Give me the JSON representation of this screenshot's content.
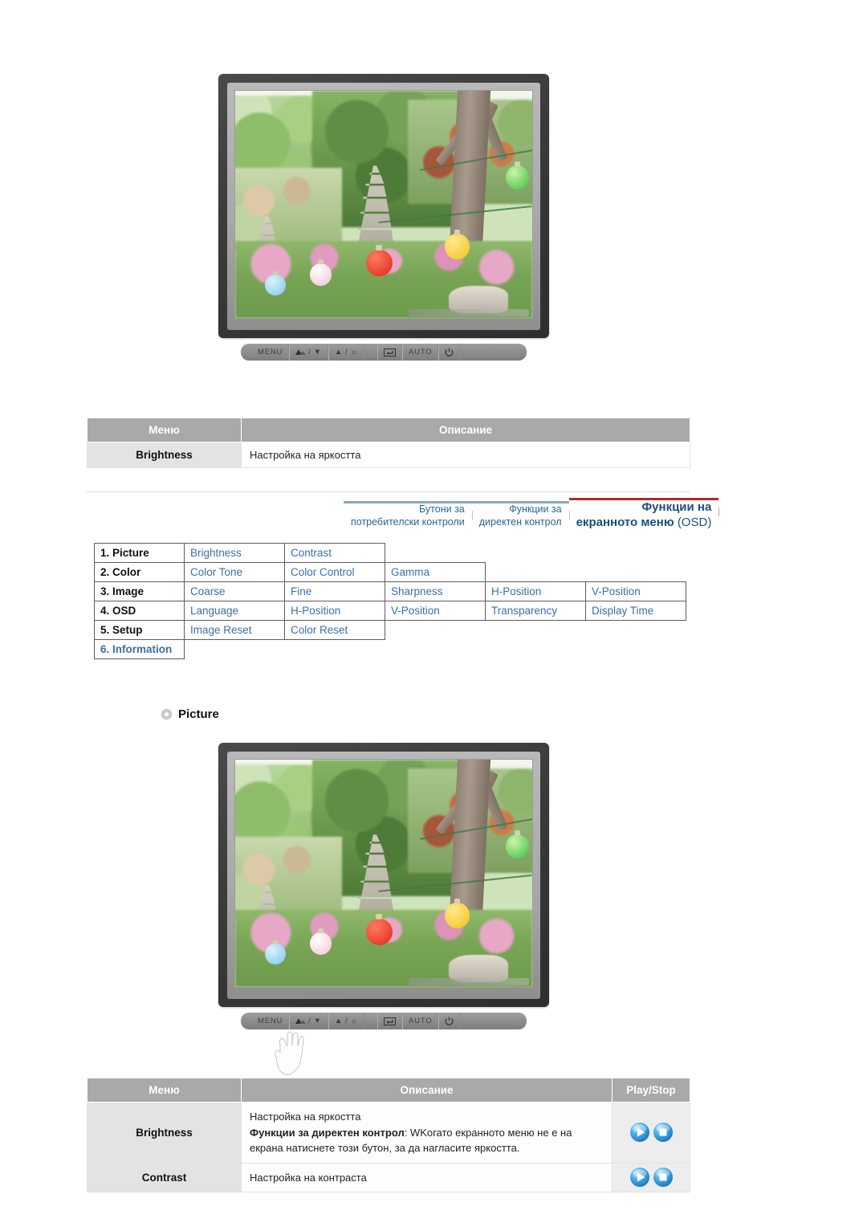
{
  "page": {
    "title": "Samsung Monitor OSD — Picture",
    "language": "bg"
  },
  "nav": {
    "tabs": [
      {
        "line1": "Бутони за",
        "line2": "потребителски контроли",
        "active": false
      },
      {
        "line1": "Функции за",
        "line2": "директен контрол",
        "active": false
      },
      {
        "line1": "Функции на",
        "line2": "екранното меню ",
        "line2_light": "(OSD)",
        "active": true
      }
    ],
    "active_color": "#b02a2a",
    "inactive_color": "#8ba7bd"
  },
  "monitor_top": {
    "buttons": [
      {
        "label": "MENU",
        "icon": "menu-button"
      },
      {
        "label": "/ ▼",
        "icon": "contrast-down-button"
      },
      {
        "label": "▲ /",
        "icon": "brightness-up-button"
      },
      {
        "label": "",
        "icon": "enter-source-button"
      },
      {
        "label": "AUTO",
        "icon": "auto-button"
      },
      {
        "label": "",
        "icon": "power-button"
      }
    ],
    "screen_scene": "garden with stone pagoda, trees and colored paper lanterns"
  },
  "monitor_bottom": {
    "buttons": [
      {
        "label": "MENU",
        "icon": "menu-button"
      },
      {
        "label": "/ ▼",
        "icon": "contrast-down-button"
      },
      {
        "label": "▲ /",
        "icon": "brightness-up-button"
      },
      {
        "label": "",
        "icon": "enter-source-button"
      },
      {
        "label": "AUTO",
        "icon": "auto-button"
      },
      {
        "label": "",
        "icon": "power-button"
      }
    ],
    "pointer": "hand-cursor pointing at MENU button",
    "screen_scene": "garden with stone pagoda, trees and colored paper lanterns"
  },
  "table_top": {
    "headers": [
      "Меню",
      "Описание"
    ],
    "rows": [
      {
        "menu": "Brightness",
        "desc": "Настройка на яркостта"
      }
    ]
  },
  "osd_structure": {
    "rows": [
      {
        "category": "1. Picture",
        "category_blue": false,
        "items": [
          "Brightness",
          "Contrast"
        ]
      },
      {
        "category": "2. Color",
        "category_blue": false,
        "items": [
          "Color Tone",
          "Color Control",
          "Gamma"
        ]
      },
      {
        "category": "3. Image",
        "category_blue": false,
        "items": [
          "Coarse",
          "Fine",
          "Sharpness",
          "H-Position",
          "V-Position"
        ]
      },
      {
        "category": "4. OSD",
        "category_blue": false,
        "items": [
          "Language",
          "H-Position",
          "V-Position",
          "Transparency",
          "Display Time"
        ]
      },
      {
        "category": "5. Setup",
        "category_blue": false,
        "items": [
          "Image Reset",
          "Color Reset"
        ]
      },
      {
        "category": "6. Information",
        "category_blue": true,
        "items": []
      }
    ],
    "item_color": "#3c6fa8"
  },
  "section": {
    "heading": "Picture",
    "icon": "diamond-bullet-icon"
  },
  "table_bottom": {
    "headers": [
      "Меню",
      "Описание",
      "Play/Stop"
    ],
    "rows": [
      {
        "menu": "Brightness",
        "desc_line1": "Настройка на яркостта",
        "desc_bold": "Функции за директен контрол",
        "desc_rest": ": WKогато екранното меню не е на екрана натиснете този бутон, за да нагласите яркостта.",
        "play_icon": "play-icon",
        "stop_icon": "stop-icon"
      },
      {
        "menu": "Contrast",
        "desc_line1": "Настройка на контраста",
        "desc_bold": "",
        "desc_rest": "",
        "play_icon": "play-icon",
        "stop_icon": "stop-icon"
      }
    ]
  },
  "colors": {
    "table_header_bg": "#a9a9a9",
    "menu_cell_bg": "#e3e3e3",
    "link_blue": "#3c6fa8",
    "accent_red": "#b02a2a",
    "play_blue": "#3aa0e0"
  }
}
